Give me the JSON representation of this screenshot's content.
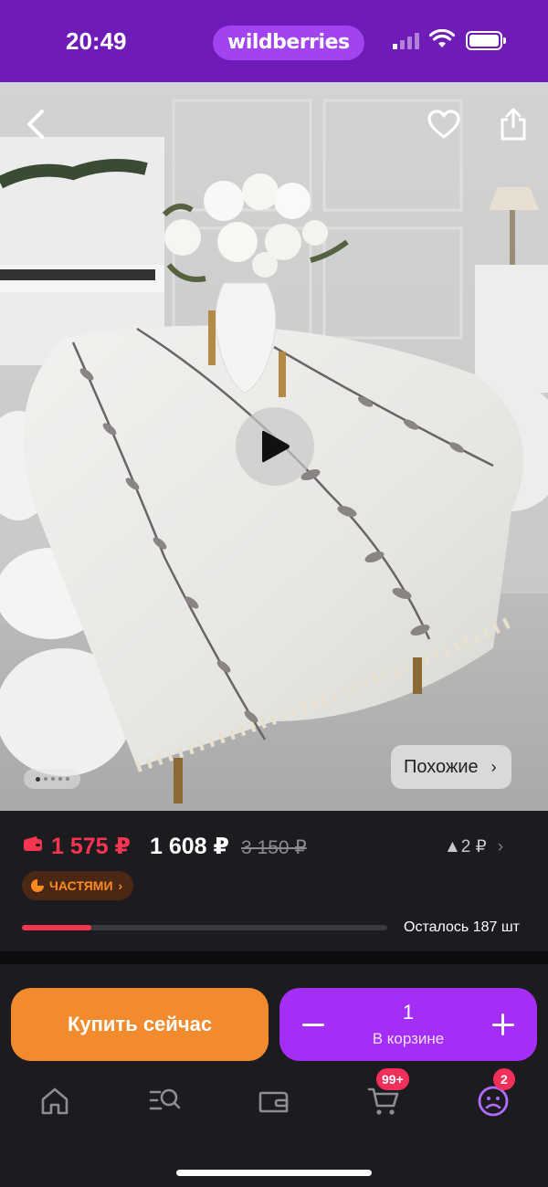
{
  "status_bar": {
    "time": "20:49",
    "brand": "wildberries"
  },
  "product": {
    "image_description_icon": "tablecloth-photo",
    "similar_label": "Похожие",
    "gallery_pages": 5,
    "gallery_active": 1
  },
  "price": {
    "wallet_price": "1 575 ₽",
    "price": "1 608 ₽",
    "old_price": "3 150 ₽",
    "price_change": "▲2 ₽",
    "installments_label": "ЧАСТЯМИ",
    "stock_text": "Осталось 187 шт",
    "stock_fraction": 0.19
  },
  "actions": {
    "buy_now_label": "Купить сейчас",
    "quantity": "1",
    "in_cart_label": "В корзине"
  },
  "tabbar": {
    "items": [
      {
        "name": "home-icon"
      },
      {
        "name": "catalog-search-icon"
      },
      {
        "name": "wallet-icon"
      },
      {
        "name": "cart-icon",
        "badge": "99+"
      },
      {
        "name": "profile-icon",
        "badge": "2"
      }
    ]
  },
  "colors": {
    "status_bar": "#6e1bb8",
    "brand_pill": "#a243f0",
    "buy_now": "#f28a2e",
    "cart": "#a42ef5",
    "accent_red": "#f73550",
    "installments_text": "#ff8a1e",
    "background": "#1c1b20"
  }
}
